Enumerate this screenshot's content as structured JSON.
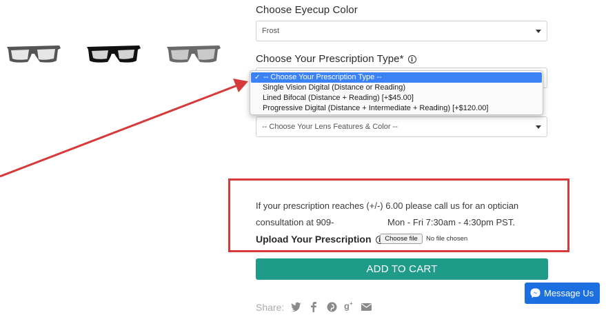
{
  "eyecup": {
    "label": "Choose Eyecup Color",
    "selected": "Frost"
  },
  "prescription_type": {
    "label": "Choose Your Prescription Type*",
    "info_icon": "info-circle-icon",
    "options": [
      "-- Choose Your Prescription Type --",
      "Single Vision Digital (Distance or Reading)",
      "Lined Bifocal (Distance + Reading) [+$45.00]",
      "Progressive Digital (Distance + Intermediate + Reading) [+$120.00]"
    ],
    "selected_index": 0
  },
  "lens_features": {
    "selected": "-- Choose Your Lens Features & Color --"
  },
  "notice": {
    "line1": "If your prescription reaches (+/-) 6.00 please call us for an optician",
    "line2_prefix": "consultation at 909-",
    "line2_suffix": "Mon - Fri 7:30am - 4:30pm PST."
  },
  "upload": {
    "label": "Upload Your Prescription",
    "button": "Choose file",
    "status": "No file chosen"
  },
  "cart": {
    "label": "ADD TO CART"
  },
  "share": {
    "label": "Share:",
    "icons": [
      "twitter-icon",
      "facebook-icon",
      "pinterest-icon",
      "google-plus-icon",
      "email-icon"
    ]
  },
  "messenger": {
    "label": "Message Us"
  },
  "colors": {
    "accent": "#1f9b8a",
    "annotation": "#d63a3a",
    "messenger": "#1b6fe0",
    "selected_option": "#3b82f6"
  }
}
